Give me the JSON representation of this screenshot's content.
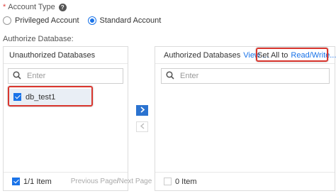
{
  "account_type": {
    "required_mark": "*",
    "label": "Account Type",
    "options": [
      {
        "label": "Privileged Account",
        "selected": false
      },
      {
        "label": "Standard Account",
        "selected": true
      }
    ]
  },
  "authorize_label": "Authorize Database:",
  "unauthorized": {
    "title": "Unauthorized Databases",
    "search_placeholder": "Enter",
    "items": [
      {
        "label": "db_test1",
        "checked": true
      }
    ],
    "footer": {
      "count": "1/1 Item",
      "prev": "Previous Page",
      "separator": "/",
      "next": "Next Page"
    }
  },
  "authorized": {
    "title": "Authorized Databases",
    "view_link": "View ...",
    "set_all_label": "Set All to",
    "set_all_value": "Read/Write...",
    "search_placeholder": "Enter",
    "footer": {
      "count": "0 Item"
    }
  },
  "colors": {
    "accent": "#1a73e8",
    "highlight_border": "#d9362e"
  }
}
